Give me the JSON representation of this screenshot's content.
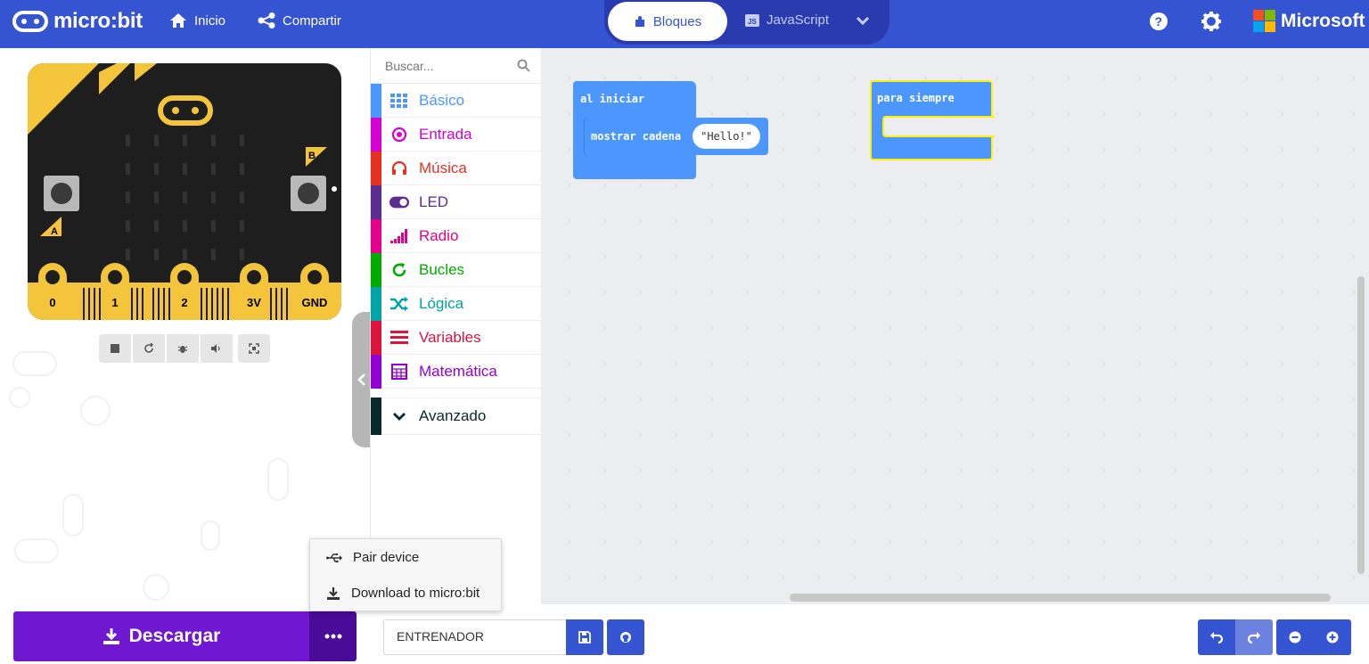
{
  "header": {
    "app_name": "micro:bit",
    "home_label": "Inicio",
    "share_label": "Compartir",
    "blocks_label": "Bloques",
    "js_label": "JavaScript",
    "ms_label": "Microsoft"
  },
  "simulator": {
    "pins": [
      "0",
      "1",
      "2",
      "3V",
      "GND"
    ],
    "button_a": "A",
    "button_b": "B"
  },
  "toolbox": {
    "search_placeholder": "Buscar...",
    "categories": [
      {
        "label": "Básico",
        "color": "#4c97ff",
        "icon": "grid-icon"
      },
      {
        "label": "Entrada",
        "color": "#d400d4",
        "icon": "target-icon"
      },
      {
        "label": "Música",
        "color": "#e63022",
        "icon": "headphones-icon"
      },
      {
        "label": "LED",
        "color": "#5c2d91",
        "icon": "toggle-icon"
      },
      {
        "label": "Radio",
        "color": "#e3008c",
        "icon": "signal-icon"
      },
      {
        "label": "Bucles",
        "color": "#00aa00",
        "icon": "refresh-icon"
      },
      {
        "label": "Lógica",
        "color": "#00a4a6",
        "icon": "shuffle-icon"
      },
      {
        "label": "Variables",
        "color": "#dc143c",
        "icon": "list-icon"
      },
      {
        "label": "Matemática",
        "color": "#9400d3",
        "icon": "calculator-icon"
      },
      {
        "label": "Avanzado",
        "color": "#0a2a2a",
        "icon": "chevron-down-icon"
      }
    ]
  },
  "workspace": {
    "on_start_label": "al iniciar",
    "show_string_label": "mostrar cadena",
    "string_value": "Hello!",
    "forever_label": "para siempre"
  },
  "popup": {
    "pair_label": "Pair device",
    "download_label": "Download to micro:bit"
  },
  "bottom": {
    "download_label": "Descargar",
    "project_name": "ENTRENADOR"
  }
}
